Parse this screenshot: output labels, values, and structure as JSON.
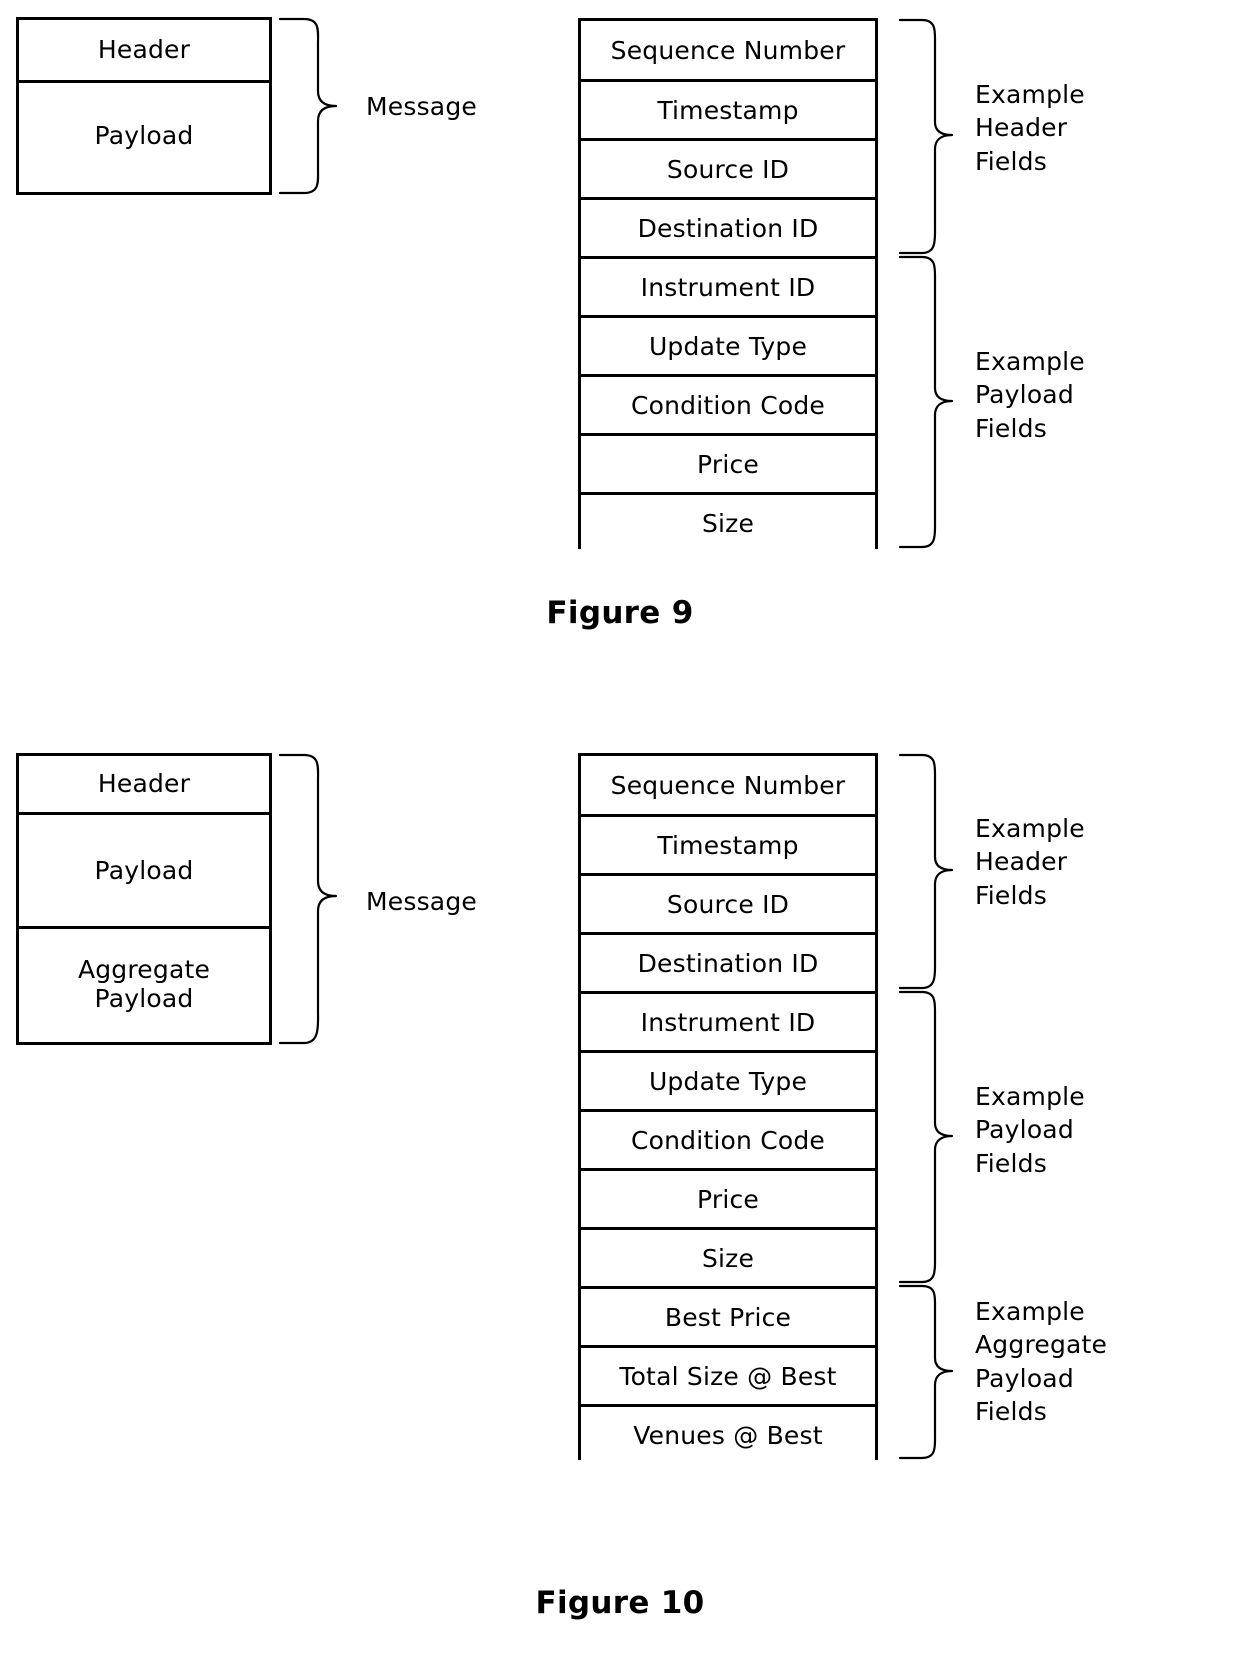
{
  "figure9": {
    "caption": "Figure 9",
    "stack": {
      "name": "message-structure",
      "rows": [
        {
          "label": "Header"
        },
        {
          "label": "Payload"
        }
      ]
    },
    "message_brace_label": "Message",
    "fields": [
      {
        "label": "Sequence Number",
        "group": "header"
      },
      {
        "label": "Timestamp",
        "group": "header"
      },
      {
        "label": "Source ID",
        "group": "header"
      },
      {
        "label": "Destination ID",
        "group": "header"
      },
      {
        "label": "Instrument ID",
        "group": "payload"
      },
      {
        "label": "Update Type",
        "group": "payload"
      },
      {
        "label": "Condition Code",
        "group": "payload"
      },
      {
        "label": "Price",
        "group": "payload"
      },
      {
        "label": "Size",
        "group": "payload"
      }
    ],
    "group_labels": {
      "header": "Example\nHeader\nFields",
      "payload": "Example\nPayload\nFields"
    }
  },
  "figure10": {
    "caption": "Figure 10",
    "stack": {
      "name": "message-structure",
      "rows": [
        {
          "label": "Header"
        },
        {
          "label": "Payload"
        },
        {
          "label": "Aggregate\nPayload"
        }
      ]
    },
    "message_brace_label": "Message",
    "fields": [
      {
        "label": "Sequence Number",
        "group": "header"
      },
      {
        "label": "Timestamp",
        "group": "header"
      },
      {
        "label": "Source ID",
        "group": "header"
      },
      {
        "label": "Destination ID",
        "group": "header"
      },
      {
        "label": "Instrument ID",
        "group": "payload"
      },
      {
        "label": "Update Type",
        "group": "payload"
      },
      {
        "label": "Condition Code",
        "group": "payload"
      },
      {
        "label": "Price",
        "group": "payload"
      },
      {
        "label": "Size",
        "group": "payload"
      },
      {
        "label": "Best Price",
        "group": "aggregate"
      },
      {
        "label": "Total Size @ Best",
        "group": "aggregate"
      },
      {
        "label": "Venues @ Best",
        "group": "aggregate"
      }
    ],
    "group_labels": {
      "header": "Example\nHeader\nFields",
      "payload": "Example\nPayload\nFields",
      "aggregate": "Example\nAggregate\nPayload\nFields"
    }
  },
  "colors": {
    "line": "#000000",
    "background": "#ffffff"
  }
}
